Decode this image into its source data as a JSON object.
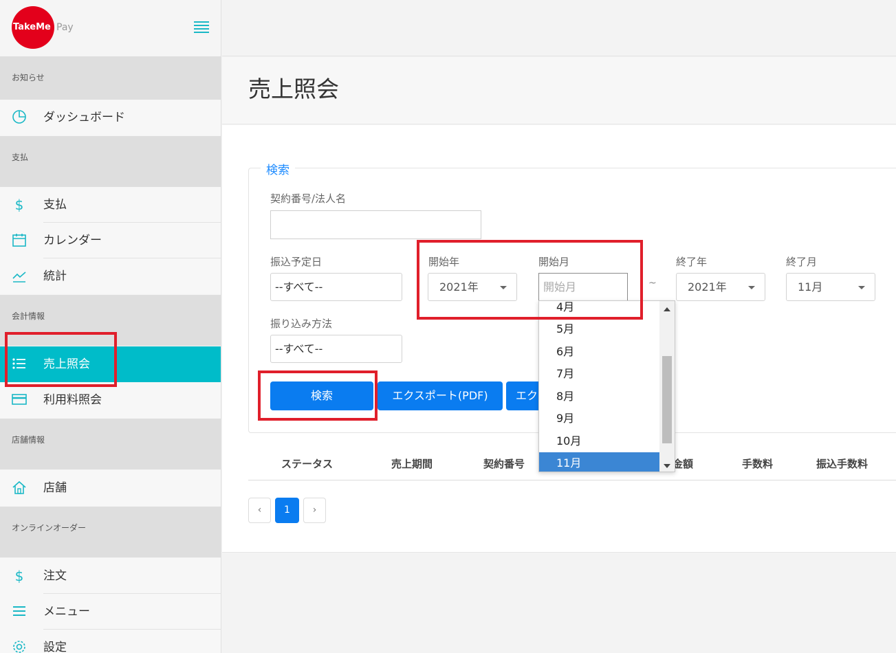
{
  "brand": {
    "logo_text": "TakeMe",
    "logo_suffix": "Pay"
  },
  "sidebar": {
    "sections": [
      {
        "header": "お知らせ",
        "items": [
          {
            "label": "ダッシュボード",
            "icon": "pie-chart-icon"
          }
        ]
      },
      {
        "header": "支払",
        "items": [
          {
            "label": "支払",
            "icon": "dollar-icon"
          },
          {
            "label": "カレンダー",
            "icon": "calendar-icon"
          },
          {
            "label": "統計",
            "icon": "line-chart-icon"
          }
        ]
      },
      {
        "header": "会計情報",
        "items": [
          {
            "label": "売上照会",
            "icon": "list-icon",
            "active": true
          },
          {
            "label": "利用料照会",
            "icon": "credit-card-icon"
          }
        ]
      },
      {
        "header": "店舗情報",
        "items": [
          {
            "label": "店舗",
            "icon": "home-icon"
          }
        ]
      },
      {
        "header": "オンラインオーダー",
        "items": [
          {
            "label": "注文",
            "icon": "dollar-icon"
          },
          {
            "label": "メニュー",
            "icon": "menu-icon"
          },
          {
            "label": "設定",
            "icon": "gear-icon"
          }
        ]
      }
    ]
  },
  "page": {
    "title": "売上照会"
  },
  "search": {
    "legend": "検索",
    "contract_label": "契約番号/法人名",
    "contract_value": "",
    "transfer_date_label": "振込予定日",
    "transfer_date_value": "--すべて--",
    "start_year_label": "開始年",
    "start_year_value": "2021年",
    "start_month_label": "開始月",
    "start_month_placeholder": "開始月",
    "tilde": "~",
    "end_year_label": "終了年",
    "end_year_value": "2021年",
    "end_month_label": "終了月",
    "end_month_value": "11月",
    "method_label": "振り込み方法",
    "method_value": "--すべて--",
    "search_button": "検索",
    "export_pdf_button": "エクスポート(PDF)",
    "export_button_partial": "エク"
  },
  "month_dropdown": {
    "options": [
      "4月",
      "5月",
      "6月",
      "7月",
      "8月",
      "9月",
      "10月",
      "11月"
    ],
    "selected": "11月"
  },
  "table": {
    "headers": [
      "ステータス",
      "売上期間",
      "契約番号",
      "金額",
      "手数料",
      "振込手数料"
    ]
  },
  "pagination": {
    "prev": "‹",
    "current": "1",
    "next": "›"
  },
  "colors": {
    "accent": "#00bcc9",
    "primary": "#0a7cf0",
    "annotation": "#e01f2b",
    "logo": "#e3001b"
  }
}
